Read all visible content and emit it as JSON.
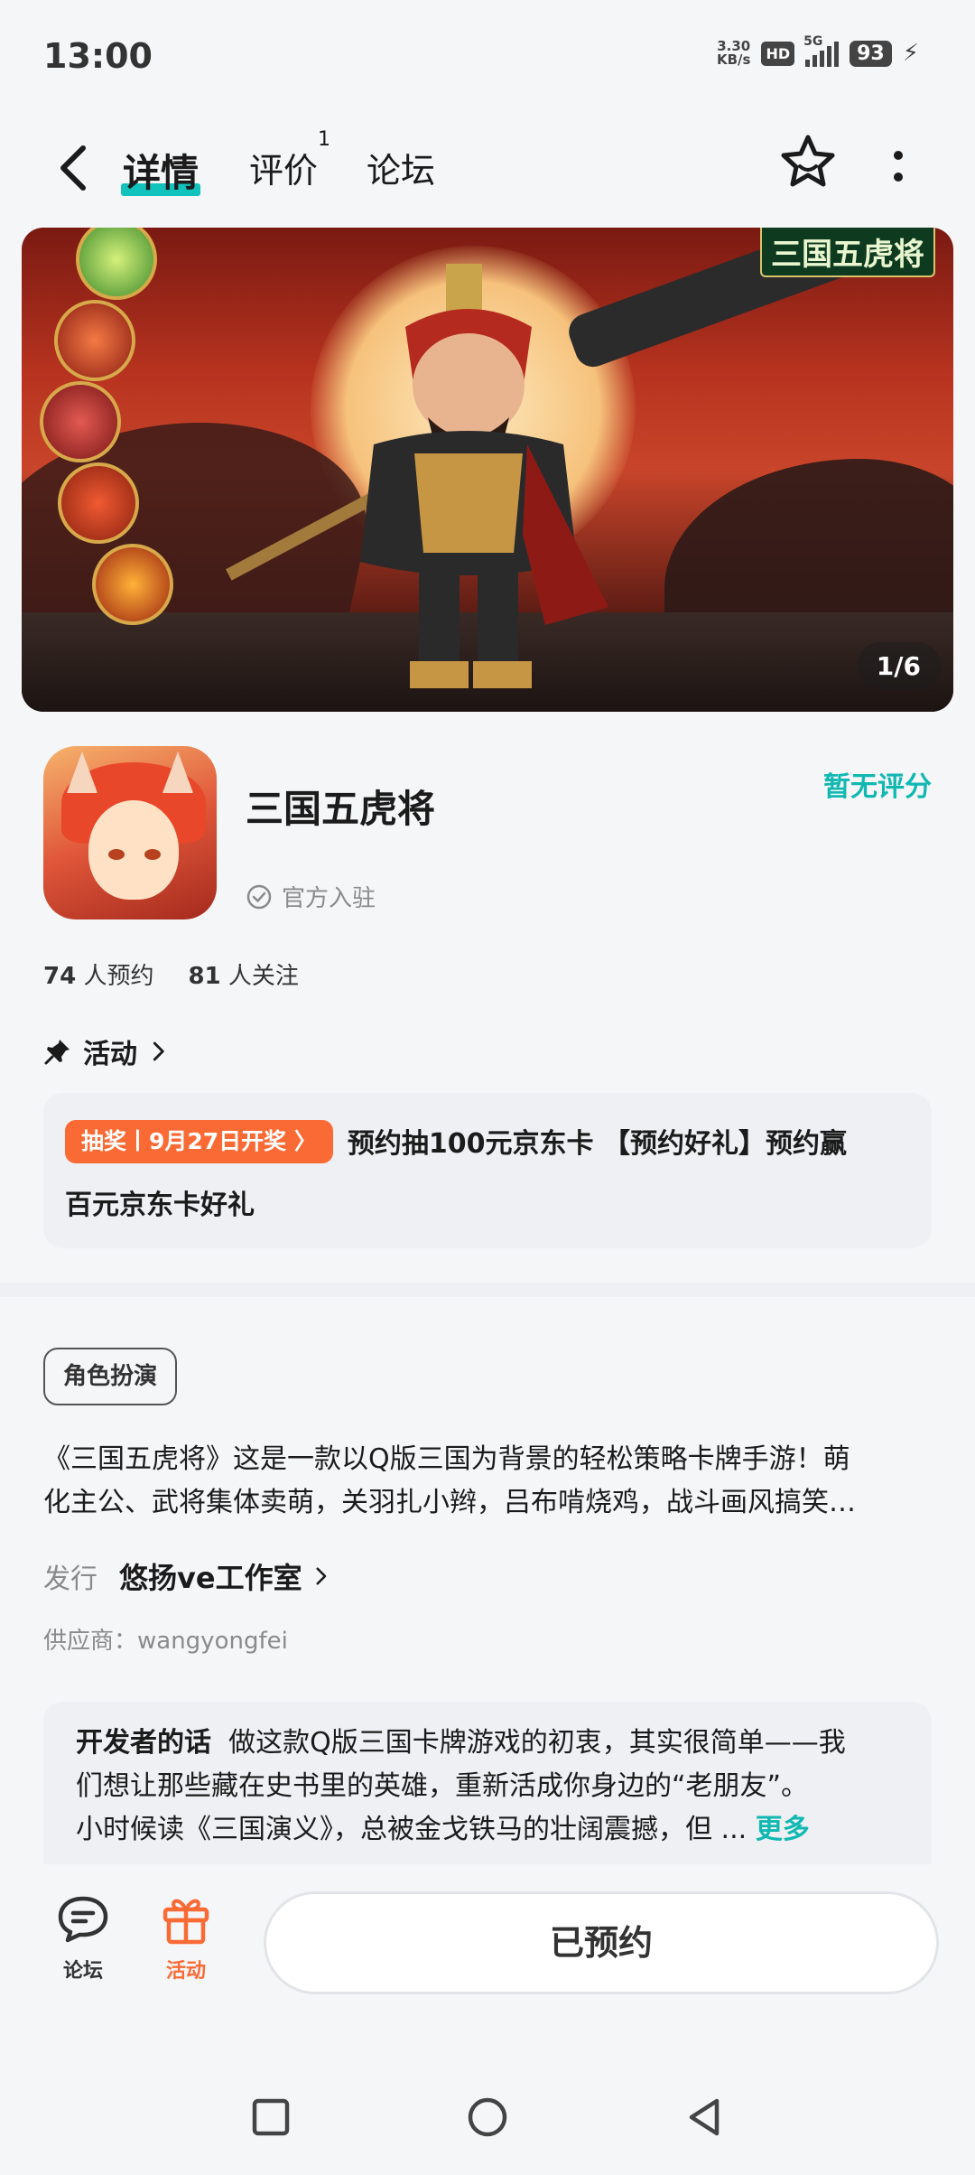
{
  "status_bar": {
    "time": "13:00",
    "net_speed_value": "3.30",
    "net_speed_unit": "KB/s",
    "hd_label": "HD",
    "network": "5G",
    "battery": "93"
  },
  "header": {
    "tabs": [
      {
        "label": "详情",
        "active": true
      },
      {
        "label": "评价",
        "badge": "1"
      },
      {
        "label": "论坛"
      }
    ],
    "icons": [
      "back-icon",
      "star-icon",
      "more-icon"
    ]
  },
  "banner": {
    "logo_text": "三国五虎将",
    "pager": "1/6"
  },
  "app": {
    "name": "三国五虎将",
    "verified_label": "官方入驻",
    "rating_label": "暂无评分"
  },
  "stats": {
    "reserve_count": "74",
    "reserve_label": "人预约",
    "follow_count": "81",
    "follow_label": "人关注"
  },
  "activity": {
    "title": "活动",
    "tag": "抽奖丨9月27日开奖 〉",
    "text_line1": "预约抽100元京东卡 【预约好礼】预约赢",
    "text_line2": "百元京东卡好礼"
  },
  "genre": "角色扮演",
  "description": {
    "line1": "《三国五虎将》这是一款以Q版三国为背景的轻松策略卡牌手游！萌",
    "line2": "化主公、武将集体卖萌，关羽扎小辫，吕布啃烧鸡，战斗画风搞笑…"
  },
  "publisher": {
    "label": "发行",
    "name": "悠扬ve工作室"
  },
  "supplier": "供应商：wangyongfei",
  "developer_note": {
    "title": "开发者的话",
    "line1": "做这款Q版三国卡牌游戏的初衷，其实很简单——我",
    "line2": "们想让那些藏在史书里的英雄，重新活成你身边的“老朋友”。",
    "line3": "小时候读《三国演义》，总被金戈铁马的壮阔震撼，但 ...",
    "more": "更多"
  },
  "bottom_bar": {
    "forum_label": "论坛",
    "activity_label": "活动",
    "reserve_button": "已预约"
  },
  "colors": {
    "accent": "#11c2bd",
    "orange": "#fa6a34",
    "text": "#1b1b1b",
    "muted": "#8a8a8a"
  }
}
